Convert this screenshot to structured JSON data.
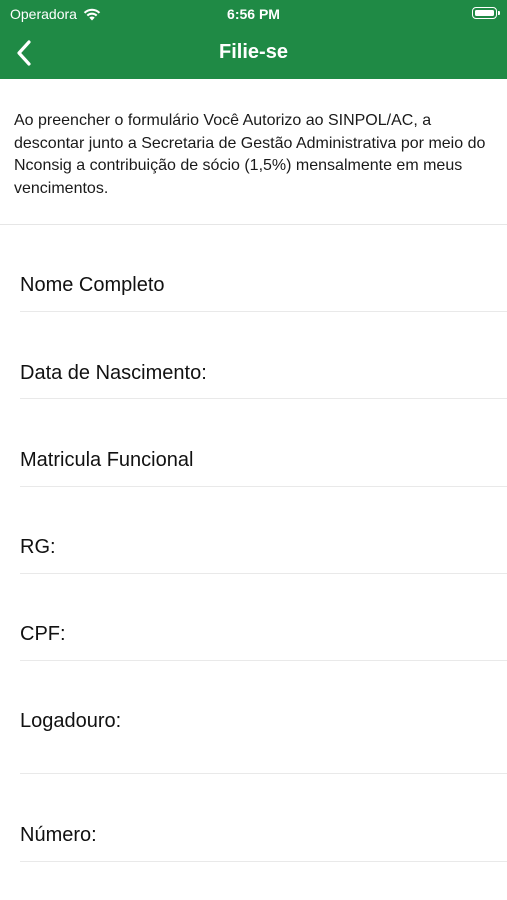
{
  "status_bar": {
    "carrier": "Operadora",
    "time": "6:56 PM",
    "wifi_icon": "wifi-icon",
    "battery_icon": "battery-icon"
  },
  "nav": {
    "title": "Filie-se",
    "back_icon": "chevron-left-icon"
  },
  "intro": "Ao preencher o formulário Você Autorizo ao SINPOL/AC, a descontar junto a Secretaria de Gestão Administrativa por meio do Nconsig a contribuição de sócio (1,5%) mensalmente em meus vencimentos.",
  "form": {
    "fields": [
      {
        "label": "Nome Completo"
      },
      {
        "label": "Data de Nascimento:"
      },
      {
        "label": "Matricula Funcional"
      },
      {
        "label": "RG:"
      },
      {
        "label": "CPF:"
      },
      {
        "label": "Logadouro:"
      },
      {
        "label": "Número:"
      }
    ]
  },
  "colors": {
    "header_green": "#1f8a45",
    "divider": "#e9e9e9"
  }
}
